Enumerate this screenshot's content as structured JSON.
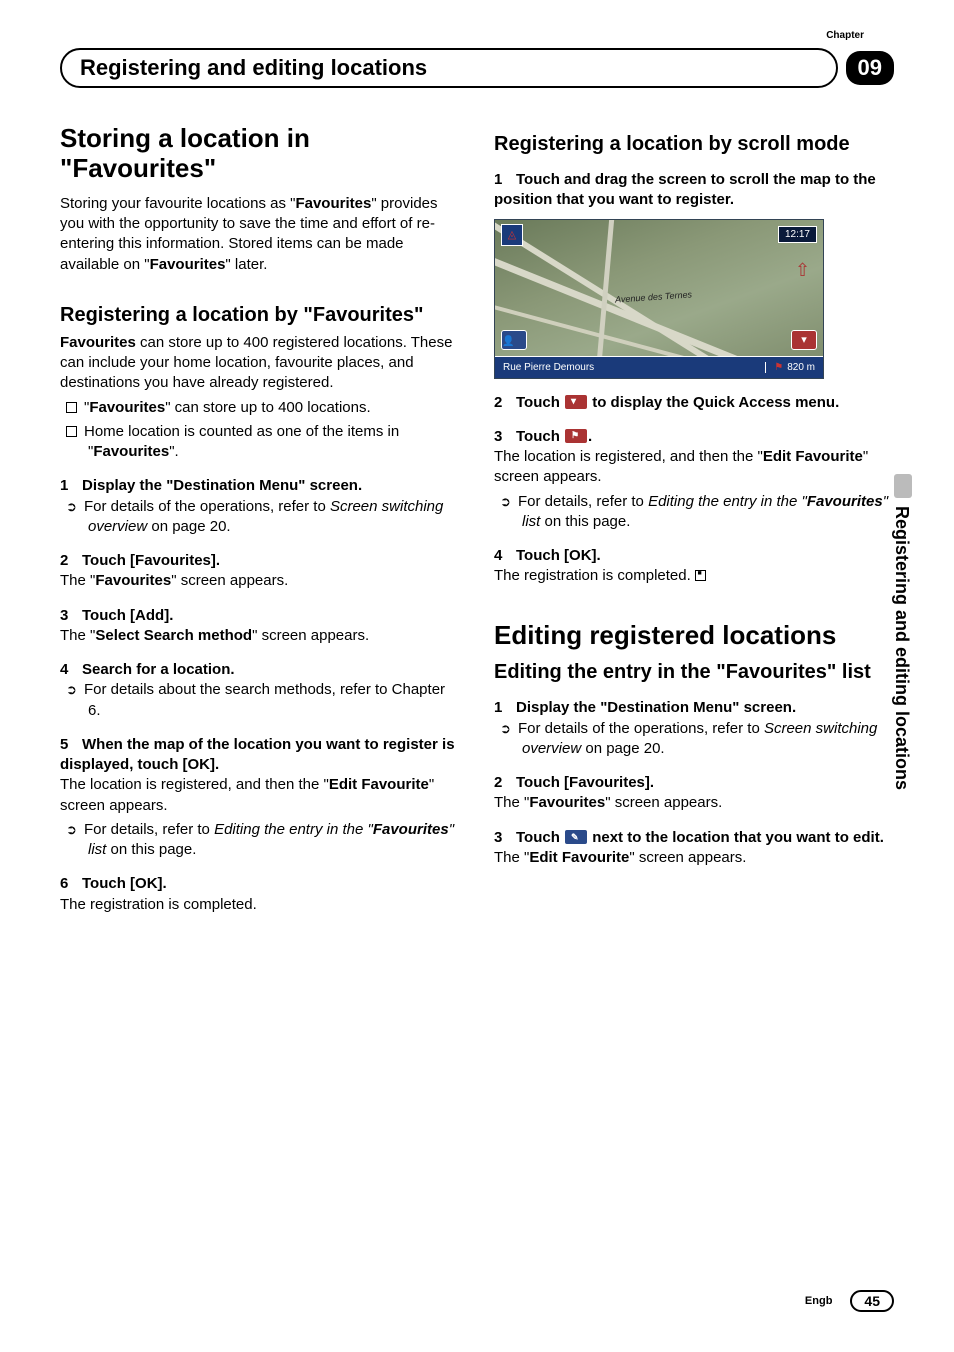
{
  "header": {
    "chapter_label": "Chapter",
    "section_title": "Registering and editing locations",
    "chapter_number": "09"
  },
  "side_tab": "Registering and editing locations",
  "left": {
    "h1": "Storing a location in \"Favourites\"",
    "intro": {
      "p1a": "Storing your favourite locations as \"",
      "p1b": "Favourites",
      "p1c": "\" provides you with the opportunity to save the time and effort of re-entering this information. Stored items can be made available on \"",
      "p1d": "Favourites",
      "p1e": "\" later."
    },
    "h2a": "Registering a location by \"Favourites\"",
    "reg_intro": {
      "a": "Favourites",
      "b": " can store up to 400 registered locations. These can include your home location, favourite places, and destinations you have already registered."
    },
    "bullet1": {
      "a": "\"",
      "b": "Favourites",
      "c": "\" can store up to 400 locations."
    },
    "bullet2": {
      "a": "Home location is counted as one of the items in \"",
      "b": "Favourites",
      "c": "\"."
    },
    "s1": {
      "num": "1",
      "head": "Display the \"Destination Menu\" screen.",
      "note_a": "For details of the operations, refer to ",
      "note_b": "Screen switching overview",
      "note_c": " on page 20."
    },
    "s2": {
      "num": "2",
      "head": "Touch [Favourites].",
      "after_a": "The \"",
      "after_b": "Favourites",
      "after_c": "\" screen appears."
    },
    "s3": {
      "num": "3",
      "head": "Touch [Add].",
      "after_a": "The \"",
      "after_b": "Select Search method",
      "after_c": "\" screen appears."
    },
    "s4": {
      "num": "4",
      "head": "Search for a location.",
      "note_a": "For details about the search methods, refer to Chapter 6."
    },
    "s5": {
      "num": "5",
      "head": "When the map of the location you want to register is displayed, touch [OK].",
      "after_a": "The location is registered, and then the \"",
      "after_b": "Edit Favourite",
      "after_c": "\" screen appears.",
      "note_a": "For details, refer to ",
      "note_b": "Editing the entry in the \"",
      "note_c": "Favourites",
      "note_d": "\" list",
      "note_e": " on this page."
    },
    "s6": {
      "num": "6",
      "head": "Touch [OK].",
      "after": "The registration is completed."
    }
  },
  "right": {
    "h2a": "Registering a location by scroll mode",
    "s1": {
      "num": "1",
      "head": "Touch and drag the screen to scroll the map to the position that you want to register."
    },
    "map": {
      "time": "12:17",
      "street_center": "Avenue des Ternes",
      "bottom_street": "Rue Pierre Demours",
      "distance": "820 m"
    },
    "s2": {
      "num": "2",
      "head_a": "Touch ",
      "head_b": " to display the Quick Access menu."
    },
    "s3": {
      "num": "3",
      "head_a": "Touch ",
      "head_b": ".",
      "after_a": "The location is registered, and then the \"",
      "after_b": "Edit Favourite",
      "after_c": "\" screen appears.",
      "note_a": "For details, refer to ",
      "note_b": "Editing the entry in the \"",
      "note_c": "Favourites",
      "note_d": "\" list",
      "note_e": " on this page."
    },
    "s4": {
      "num": "4",
      "head": "Touch [OK].",
      "after": "The registration is completed."
    },
    "h1b": "Editing registered locations",
    "h2b": "Editing the entry in the \"Favourites\" list",
    "e1": {
      "num": "1",
      "head": "Display the \"Destination Menu\" screen.",
      "note_a": "For details of the operations, refer to ",
      "note_b": "Screen switching overview",
      "note_c": " on page 20."
    },
    "e2": {
      "num": "2",
      "head": "Touch [Favourites].",
      "after_a": "The \"",
      "after_b": "Favourites",
      "after_c": "\" screen appears."
    },
    "e3": {
      "num": "3",
      "head_a": "Touch ",
      "head_b": " next to the location that you want to edit.",
      "after_a": "The \"",
      "after_b": "Edit Favourite",
      "after_c": "\" screen appears."
    }
  },
  "footer": {
    "lang": "Engb",
    "page": "45"
  }
}
